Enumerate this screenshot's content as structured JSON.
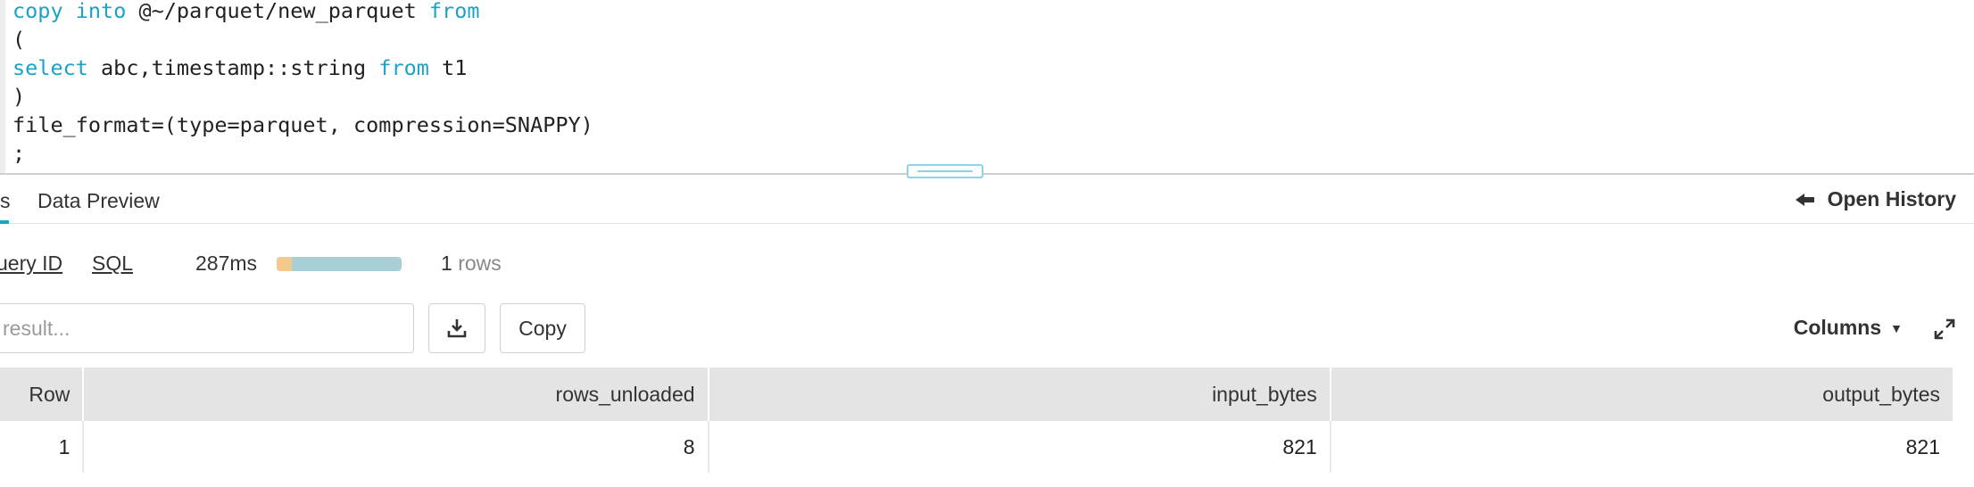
{
  "editor": {
    "lines": [
      [
        {
          "t": "copy",
          "k": true
        },
        {
          "t": " "
        },
        {
          "t": "into",
          "k": true
        },
        {
          "t": " @~/parquet/new_parquet "
        },
        {
          "t": "from",
          "k": true
        }
      ],
      [
        {
          "t": "("
        }
      ],
      [
        {
          "t": "select",
          "k": true
        },
        {
          "t": " abc,timestamp::string "
        },
        {
          "t": "from",
          "k": true
        },
        {
          "t": " t1"
        }
      ],
      [
        {
          "t": ")"
        }
      ],
      [
        {
          "t": "file_format=(type=parquet, compression=SNAPPY)"
        }
      ],
      [
        {
          "t": ";"
        }
      ]
    ]
  },
  "tabs": {
    "results_label": "s",
    "preview_label": "Data Preview",
    "open_history_label": "Open History"
  },
  "stats": {
    "query_id_label": "uery ID",
    "sql_label": "SQL",
    "duration": "287ms",
    "progress_fraction": 0.12,
    "rows_count": "1",
    "rows_unit": "rows"
  },
  "toolbar": {
    "search_placeholder": "result...",
    "copy_label": "Copy",
    "columns_label": "Columns"
  },
  "table": {
    "headers": [
      "Row",
      "rows_unloaded",
      "input_bytes",
      "output_bytes"
    ],
    "rows": [
      [
        "1",
        "8",
        "821",
        "821"
      ]
    ]
  },
  "icons": {
    "open_history": "arrow-left-icon",
    "download": "download-icon",
    "columns_caret": "caret-down-icon",
    "expand": "expand-icon"
  },
  "colors": {
    "keyword": "#1aa3c7",
    "accent": "#1aa3c7",
    "bar_track": "#a9cfd6",
    "bar_fill": "#f4c98e"
  }
}
